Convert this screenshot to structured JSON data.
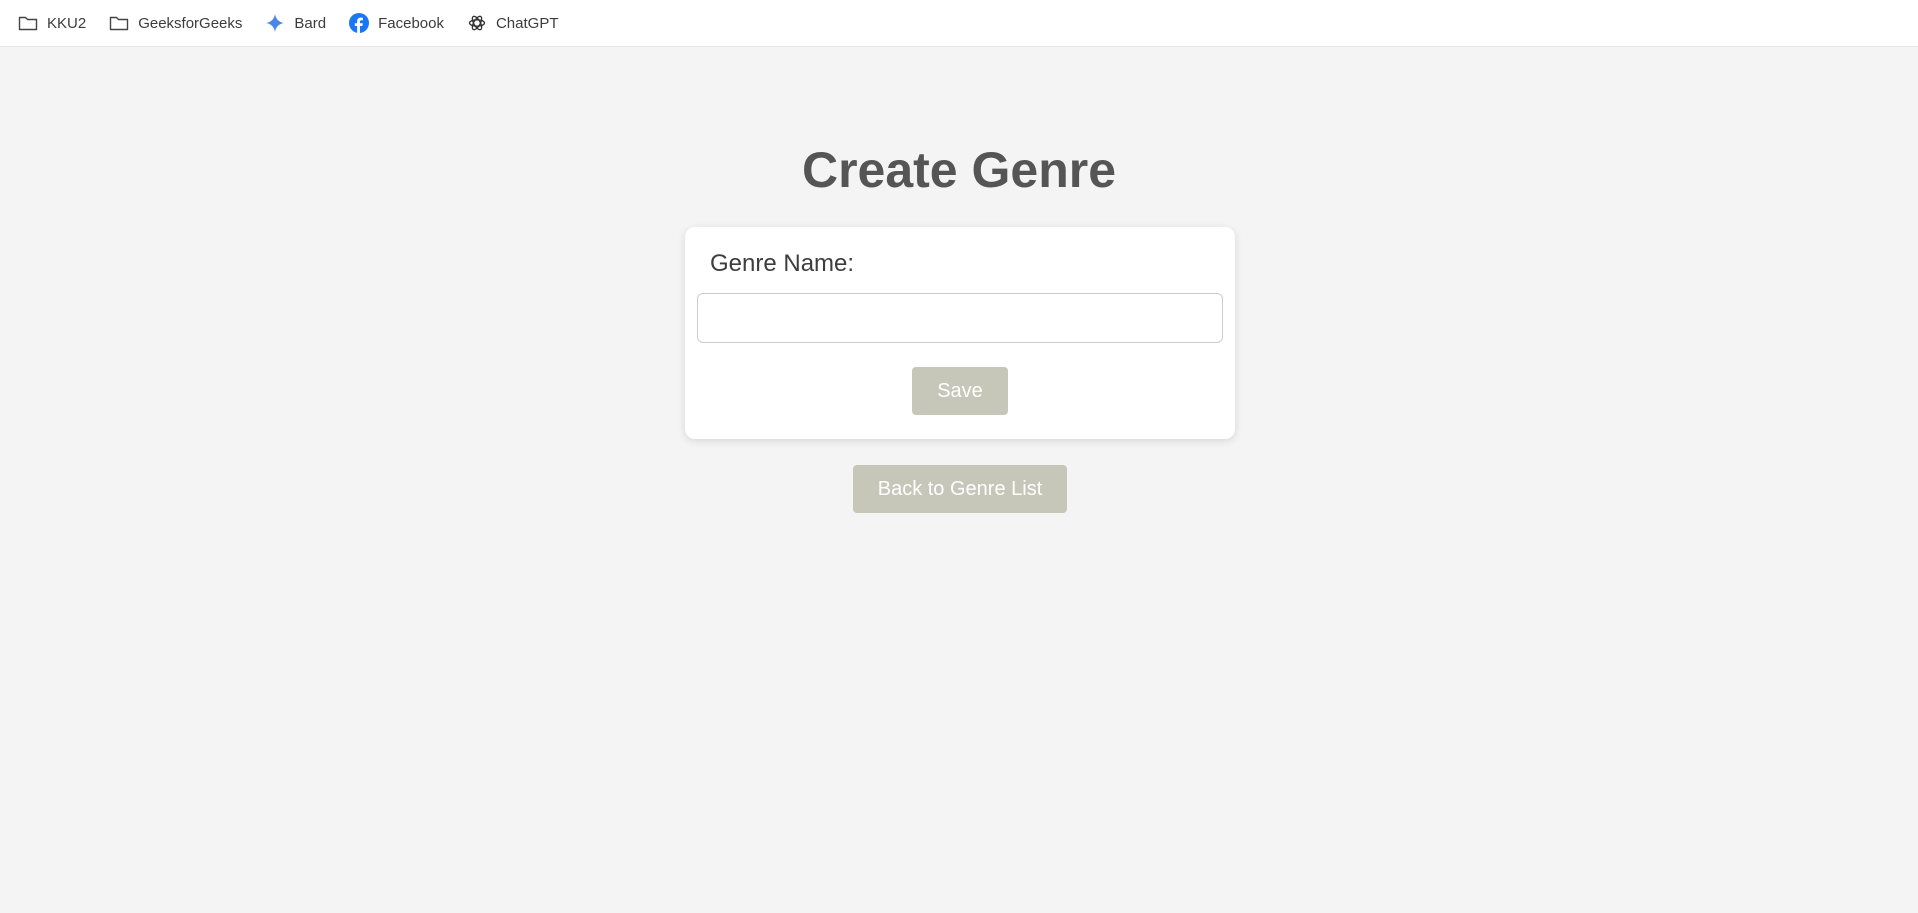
{
  "bookmarks": [
    {
      "label": "KKU2",
      "icon": "folder-icon"
    },
    {
      "label": "GeeksforGeeks",
      "icon": "folder-icon"
    },
    {
      "label": "Bard",
      "icon": "bard-sparkle-icon"
    },
    {
      "label": "Facebook",
      "icon": "facebook-icon"
    },
    {
      "label": "ChatGPT",
      "icon": "chatgpt-icon"
    }
  ],
  "page": {
    "title": "Create Genre"
  },
  "form": {
    "genre_label": "Genre Name:",
    "genre_value": "",
    "genre_placeholder": "",
    "save_label": "Save"
  },
  "nav": {
    "back_label": "Back to Genre List"
  },
  "colors": {
    "background": "#f4f4f4",
    "title": "#555555",
    "button": "#c6c6b9",
    "facebook": "#1877f2",
    "bard": "#4a86e8"
  }
}
